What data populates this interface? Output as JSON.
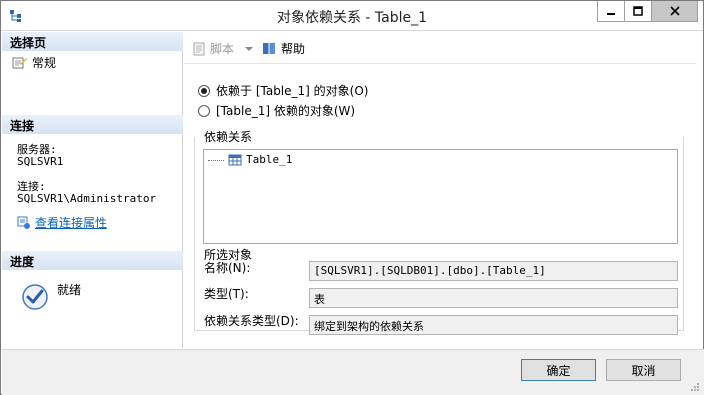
{
  "window": {
    "title": "对象依赖关系 - Table_1",
    "app_icon": "dependency-icon",
    "controls": {
      "minimize": "minimize-icon",
      "maximize": "maximize-icon",
      "close": "close-icon"
    }
  },
  "left": {
    "select_page": {
      "header": "选择页",
      "items": [
        {
          "label": "常规",
          "icon": "page-icon"
        }
      ]
    },
    "connection": {
      "header": "连接",
      "server_label": "服务器:",
      "server_value": "SQLSVR1",
      "conn_label": "连接:",
      "conn_value": "SQLSVR1\\Administrator",
      "link_label": "查看连接属性",
      "link_icon": "properties-icon"
    },
    "progress": {
      "header": "进度",
      "status": "就绪",
      "icon": "ready-check-icon"
    }
  },
  "toolbar": {
    "script_label": "脚本",
    "script_icon": "script-icon",
    "script_dropdown_icon": "chevron-down-icon",
    "help_label": "帮助",
    "help_icon": "help-icon"
  },
  "main": {
    "radios": [
      {
        "label": "依赖于 [Table_1] 的对象(O)",
        "selected": true
      },
      {
        "label": "[Table_1] 依赖的对象(W)",
        "selected": false
      }
    ],
    "group_label": "依赖关系",
    "tree": [
      {
        "label": "Table_1",
        "icon": "table-icon"
      }
    ],
    "selected_object": {
      "header": "所选对象",
      "name_label": "名称(N):",
      "name_value": "[SQLSVR1].[SQLDB01].[dbo].[Table_1]",
      "type_label": "类型(T):",
      "type_value": "表",
      "dep_type_label": "依赖关系类型(D):",
      "dep_type_value": "绑定到架构的依赖关系"
    }
  },
  "buttons": {
    "ok": "确定",
    "cancel": "取消"
  },
  "colors": {
    "accent": "#0b63b6",
    "section_header": "#d6e3f3",
    "close_button": "#c7c7c7"
  }
}
